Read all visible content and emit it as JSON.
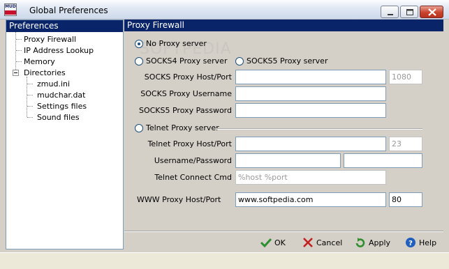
{
  "window": {
    "title": "Global Preferences",
    "app_icon_text": "MUD"
  },
  "left": {
    "header": "Preferences",
    "tree": [
      {
        "label": "Proxy Firewall"
      },
      {
        "label": "IP Address Lookup"
      },
      {
        "label": "Memory"
      },
      {
        "label": "Directories"
      },
      {
        "label": "zmud.ini"
      },
      {
        "label": "mudchar.dat"
      },
      {
        "label": "Settings files"
      },
      {
        "label": "Sound files"
      }
    ]
  },
  "right": {
    "header": "Proxy Firewall",
    "watermark": "SOFTPEDIA",
    "radios": {
      "no_proxy": "No Proxy server",
      "socks4": "SOCKS4 Proxy server",
      "socks5": "SOCKS5 Proxy server",
      "telnet": "Telnet Proxy server"
    },
    "labels": {
      "socks_host_port": "SOCKS Proxy Host/Port",
      "socks_username": "SOCKS Proxy Username",
      "socks5_password": "SOCKS5 Proxy Password",
      "telnet_host_port": "Telnet Proxy Host/Port",
      "telnet_user_pass": "Username/Password",
      "telnet_cmd": "Telnet Connect Cmd",
      "www_host_port": "WWW Proxy Host/Port"
    },
    "values": {
      "socks_host": "",
      "socks_port": "1080",
      "socks_username": "",
      "socks5_password": "",
      "telnet_host": "",
      "telnet_port": "23",
      "telnet_username": "",
      "telnet_password": "",
      "telnet_cmd": "%host %port",
      "www_host": "www.softpedia.com",
      "www_port": "80"
    }
  },
  "buttons": {
    "ok": "OK",
    "cancel": "Cancel",
    "apply": "Apply",
    "help": "Help"
  },
  "colors": {
    "header_bg": "#0a246a",
    "ok_icon": "#2f8f2f",
    "cancel_icon": "#c41f1f",
    "apply_icon": "#2f8f2f",
    "help_icon": "#1f5fbf"
  }
}
